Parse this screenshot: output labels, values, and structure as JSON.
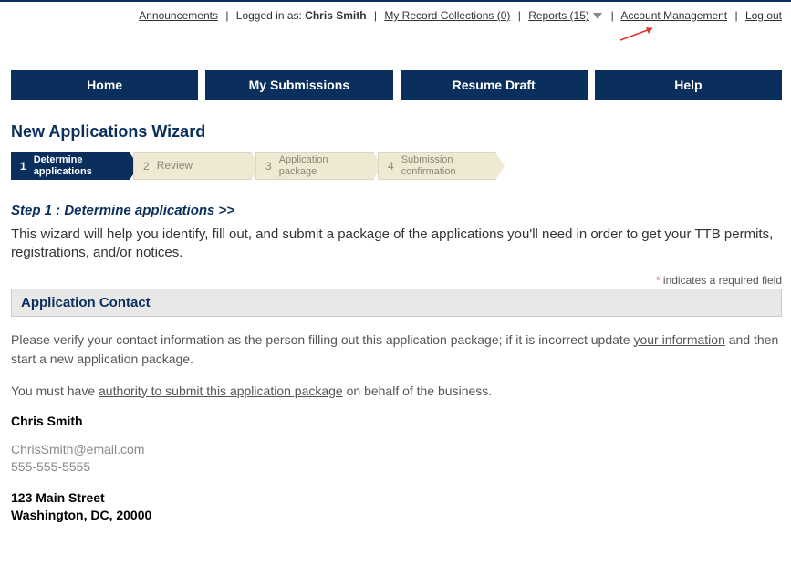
{
  "topbar": {
    "announcements": "Announcements",
    "logged_in_prefix": "Logged in as: ",
    "user_name": "Chris Smith",
    "my_collections": "My Record Collections (0)",
    "reports": "Reports (15)",
    "account_mgmt": "Account Management",
    "log_out": "Log out"
  },
  "nav": {
    "home": "Home",
    "my_submissions": "My Submissions",
    "resume_draft": "Resume Draft",
    "help": "Help"
  },
  "page_title": "New Applications Wizard",
  "wizard": {
    "s1_num": "1",
    "s1_label": "Determine applications",
    "s2_num": "2",
    "s2_label": "Review",
    "s3_num": "3",
    "s3_label": "Application package",
    "s4_num": "4",
    "s4_label": "Submission confirmation"
  },
  "step_heading": "Step 1 : Determine applications >>",
  "intro_text": "This wizard will help you identify, fill out, and submit a package of the applications you'll need in order to get your TTB permits, registrations, and/or notices.",
  "required_note": "indicates a required field",
  "section_header": "Application Contact",
  "verify_text_1": "Please verify your contact information as the person filling out this application package; if it is incorrect update ",
  "verify_link": "your information",
  "verify_text_2": " and then start a new application package.",
  "authority_text_1": "You must have ",
  "authority_link": "authority to submit this application package",
  "authority_text_2": " on behalf of the business.",
  "contact": {
    "name": "Chris  Smith",
    "email": "ChrisSmith@email.com",
    "phone": "555-555-5555",
    "street": "123 Main Street",
    "city_state_zip": "Washington, DC, 20000"
  }
}
